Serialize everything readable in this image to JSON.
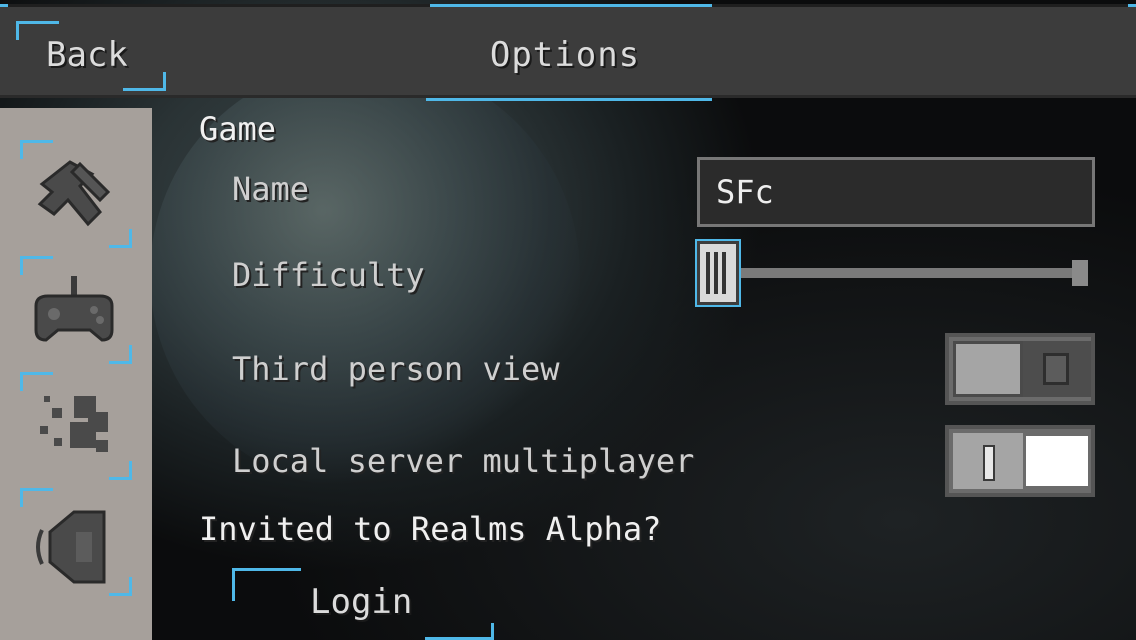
{
  "header": {
    "back_label": "Back",
    "title": "Options"
  },
  "sidebar": {
    "items": [
      {
        "icon": "game-settings-icon",
        "selected": true
      },
      {
        "icon": "controller-icon",
        "selected": false
      },
      {
        "icon": "video-particles-icon",
        "selected": false
      },
      {
        "icon": "speaker-icon",
        "selected": false
      }
    ]
  },
  "game": {
    "section_label": "Game",
    "name_label": "Name",
    "name_value": "SFc",
    "difficulty_label": "Difficulty",
    "difficulty_level": 0,
    "third_person_label": "Third person view",
    "third_person_on": false,
    "local_mp_label": "Local server multiplayer",
    "local_mp_on": true
  },
  "realms": {
    "heading": "Invited to Realms Alpha?",
    "login_label": "Login"
  },
  "colors": {
    "accent": "#4fb8e8",
    "sidebar_bg": "#a6a09b",
    "bar_bg": "#3c3c3c"
  }
}
